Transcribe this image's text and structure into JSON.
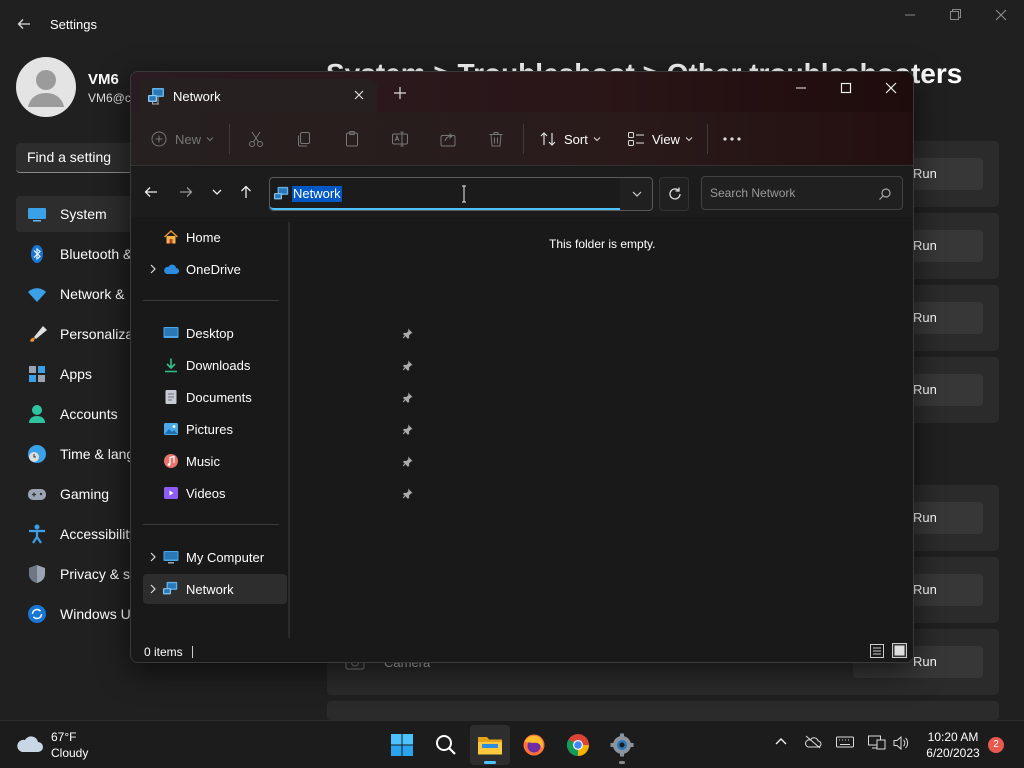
{
  "settings": {
    "title": "Settings",
    "user": {
      "name": "VM6",
      "email": "VM6@c"
    },
    "search_placeholder": "Find a setting",
    "nav": [
      {
        "label": "System"
      },
      {
        "label": "Bluetooth &"
      },
      {
        "label": "Network &"
      },
      {
        "label": "Personaliza"
      },
      {
        "label": "Apps"
      },
      {
        "label": "Accounts"
      },
      {
        "label": "Time & lang"
      },
      {
        "label": "Gaming"
      },
      {
        "label": "Accessibility"
      },
      {
        "label": "Privacy & se"
      },
      {
        "label": "Windows U"
      }
    ],
    "heading": "System  >  Troubleshoot  >  Other troubleshooters",
    "run_label": "Run",
    "camera_label": "Camera"
  },
  "explorer": {
    "tab_title": "Network",
    "toolbar": {
      "new_label": "New",
      "sort_label": "Sort",
      "view_label": "View"
    },
    "address": "Network",
    "search_placeholder": "Search Network",
    "pane": {
      "home": "Home",
      "onedrive": "OneDrive",
      "desktop": "Desktop",
      "downloads": "Downloads",
      "documents": "Documents",
      "pictures": "Pictures",
      "music": "Music",
      "videos": "Videos",
      "my_computer": "My Computer",
      "network": "Network"
    },
    "empty_message": "This folder is empty.",
    "status": "0 items"
  },
  "taskbar": {
    "weather_temp": "67°F",
    "weather_cond": "Cloudy",
    "time": "10:20 AM",
    "date": "6/20/2023",
    "notification_count": "2"
  },
  "colors": {
    "accent": "#4cc2ff",
    "selection": "#0058c5",
    "badge": "#e8594f"
  }
}
